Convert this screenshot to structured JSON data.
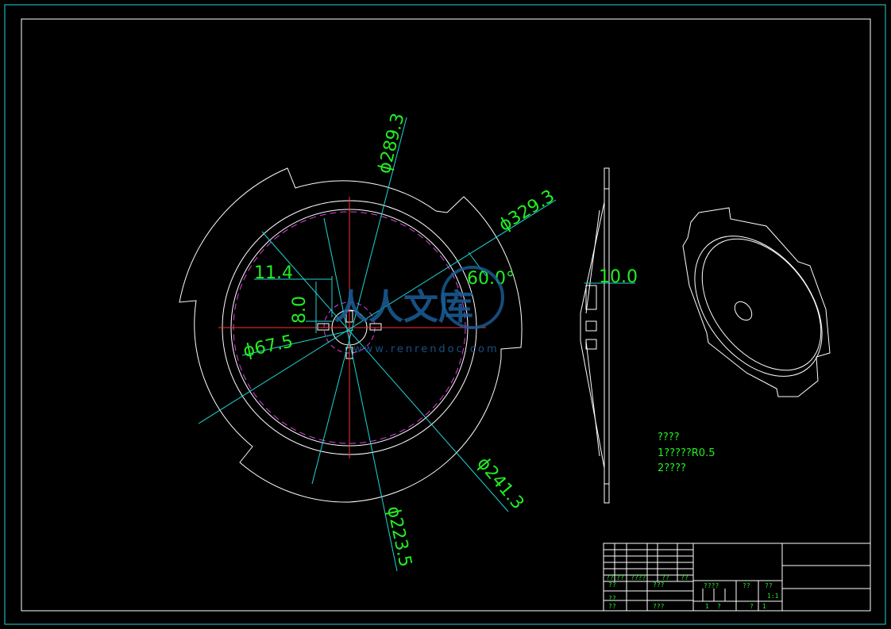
{
  "dimensions": {
    "dia_outer": "ϕ329.3",
    "dia_289": "ϕ289.3",
    "dia_241": "ϕ241.3",
    "dia_223": "ϕ223.5",
    "dia_hub": "ϕ67.5",
    "angle": "60.0°",
    "slot_width": "11.4",
    "slot_depth": "8.0",
    "thickness": "10.0"
  },
  "notes": {
    "line1": "????",
    "line2": "1?????R0.5",
    "line3": "2????"
  },
  "watermark": {
    "text": "人人文库",
    "url": "www.renrendoc.com"
  },
  "title_block": {
    "r1a": "??",
    "r1b": "??",
    "r1c": "????",
    "r1d": "??",
    "r1e": "??",
    "r2a": "??",
    "r2b": "???",
    "r3a": "??",
    "r4a": "??",
    "r4b": "???",
    "f1": "????",
    "f2": "??",
    "f3": "??",
    "f4": "1:1",
    "f5": "1",
    "f6": "?",
    "f7": "?",
    "f8": "1"
  },
  "colors": {
    "frame": "#1fd6d6",
    "outline": "#ffffff",
    "centerline": "#ff3030",
    "hidden": "#e040e0",
    "dimension": "#22ee22",
    "leader": "#1fd6d6"
  }
}
